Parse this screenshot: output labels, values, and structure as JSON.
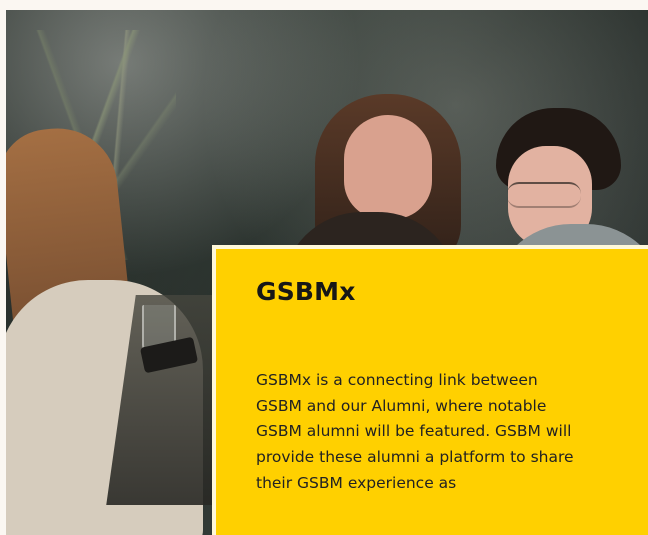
{
  "colors": {
    "page_background": "#fbf7f2",
    "card_background": "#ffd000",
    "text": "#171717"
  },
  "feature_card": {
    "title": "GSBMx",
    "description": "GSBMx is a connecting link between GSBM and our Alumni, where notable GSBM alumni will be featured. GSBM will provide these alumni a platform to share their GSBM experience as"
  },
  "hero_image": {
    "alt": "people laughing around a table"
  }
}
